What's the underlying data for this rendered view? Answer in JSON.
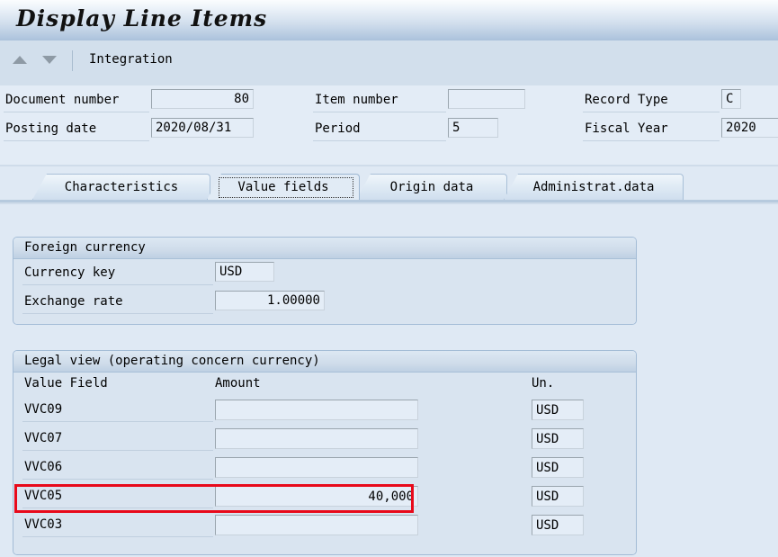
{
  "window": {
    "title": "Display Line Items"
  },
  "toolbar": {
    "prev_icon": "triangle-up-icon",
    "next_icon": "triangle-down-icon",
    "label": "Integration"
  },
  "header_fields": {
    "document_number": {
      "label": "Document number",
      "value": "80"
    },
    "posting_date": {
      "label": "Posting date",
      "value": "2020/08/31"
    },
    "item_number": {
      "label": "Item number",
      "value": ""
    },
    "period": {
      "label": "Period",
      "value": "5"
    },
    "record_type": {
      "label": "Record Type",
      "value": "C"
    },
    "fiscal_year": {
      "label": "Fiscal Year",
      "value": "2020"
    }
  },
  "tabs": [
    {
      "label": "Characteristics",
      "active": false
    },
    {
      "label": "Value fields",
      "active": true
    },
    {
      "label": "Origin data",
      "active": false
    },
    {
      "label": "Administrat.data",
      "active": false
    }
  ],
  "foreign_currency": {
    "title": "Foreign currency",
    "currency_key": {
      "label": "Currency key",
      "value": "USD"
    },
    "exchange_rate": {
      "label": "Exchange rate",
      "value": "1.00000"
    }
  },
  "legal_view": {
    "title": "Legal view (operating concern currency)",
    "columns": {
      "value_field": "Value Field",
      "amount": "Amount",
      "unit": "Un."
    },
    "rows": [
      {
        "value_field": "VVC09",
        "amount": "",
        "unit": "USD",
        "highlighted": false
      },
      {
        "value_field": "VVC07",
        "amount": "",
        "unit": "USD",
        "highlighted": false
      },
      {
        "value_field": "VVC06",
        "amount": "",
        "unit": "USD",
        "highlighted": false
      },
      {
        "value_field": "VVC05",
        "amount": "40,000",
        "unit": "USD",
        "highlighted": true
      },
      {
        "value_field": "VVC03",
        "amount": "",
        "unit": "USD",
        "highlighted": false
      }
    ]
  },
  "colors": {
    "background": "#dfe9f4",
    "titlebar_accent": "#aec4dd",
    "panel": "#d9e4f0",
    "field_fill": "#e4edf7",
    "highlight_red": "#e8091a"
  }
}
